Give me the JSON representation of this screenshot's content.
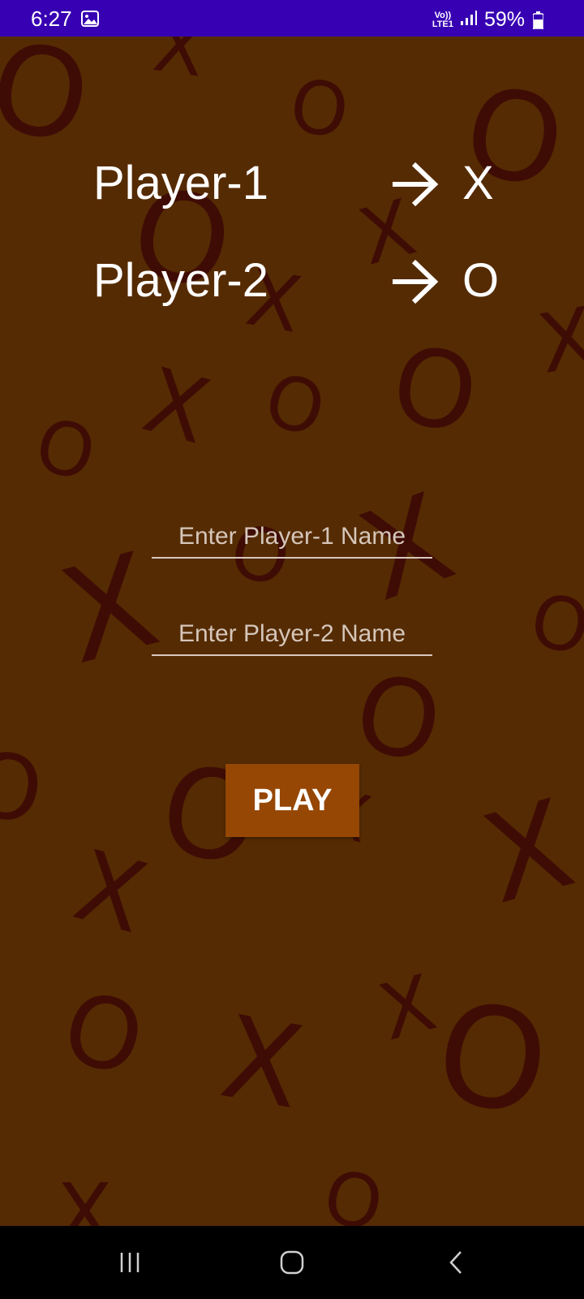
{
  "status_bar": {
    "time": "6:27",
    "network_top": "Vo))",
    "network_bottom": "LTE1",
    "battery": "59%",
    "icons": [
      "gallery-icon",
      "signal-icon",
      "battery-icon"
    ]
  },
  "players": [
    {
      "label": "Player-1",
      "symbol": "X"
    },
    {
      "label": "Player-2",
      "symbol": "O"
    }
  ],
  "inputs": {
    "player1_placeholder": "Enter Player-1 Name",
    "player2_placeholder": "Enter Player-2 Name",
    "player1_value": "",
    "player2_value": ""
  },
  "play_button": {
    "label": "PLAY"
  },
  "background_marks": {
    "x_glyph": "X",
    "o_glyph": "O"
  },
  "colors": {
    "background": "#552b03",
    "status_bar": "#3700b3",
    "play_button": "#964704",
    "pattern": "#3f0c05",
    "text": "#ffffff"
  },
  "nav_bar": {
    "icons": [
      "recent-apps-icon",
      "home-icon",
      "back-icon"
    ]
  }
}
